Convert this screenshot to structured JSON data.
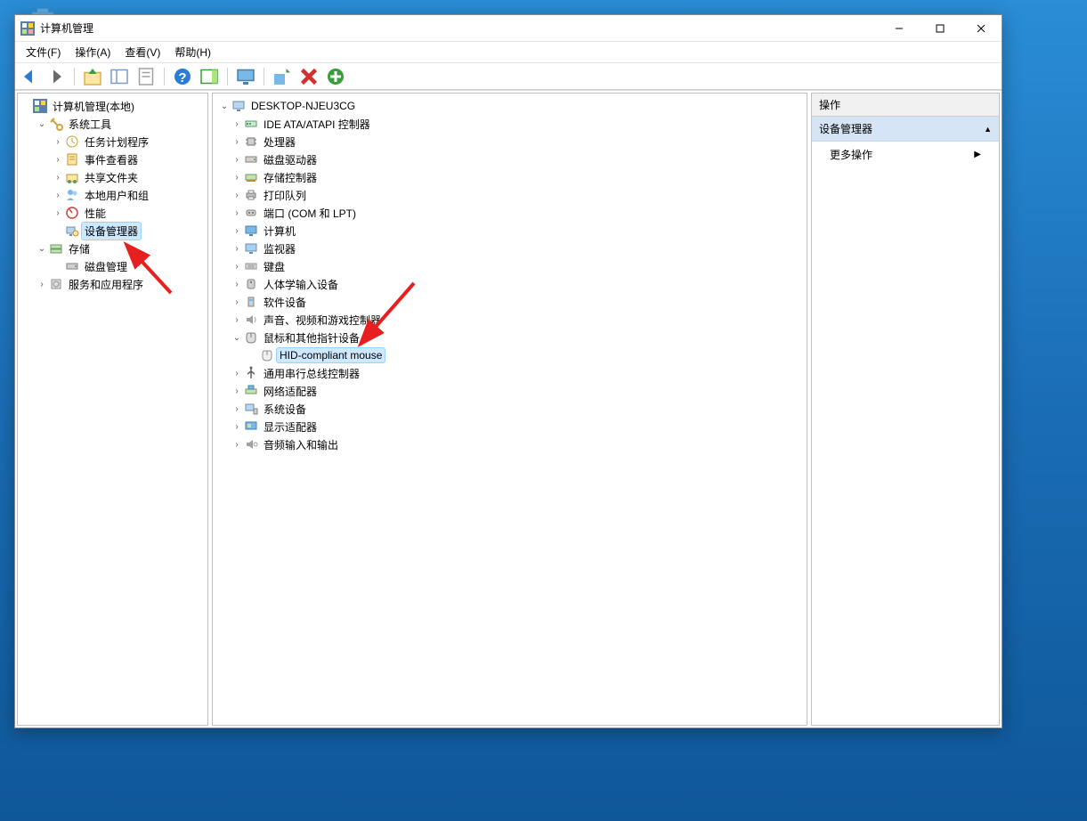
{
  "window": {
    "title": "计算机管理"
  },
  "menubar": {
    "items": [
      "文件(F)",
      "操作(A)",
      "查看(V)",
      "帮助(H)"
    ]
  },
  "left_tree": {
    "root": "计算机管理(本地)",
    "system_tools": {
      "label": "系统工具",
      "task_scheduler": "任务计划程序",
      "event_viewer": "事件查看器",
      "shared_folders": "共享文件夹",
      "local_users": "本地用户和组",
      "performance": "性能",
      "device_manager": "设备管理器"
    },
    "storage": {
      "label": "存储",
      "disk_mgmt": "磁盘管理"
    },
    "services": "服务和应用程序"
  },
  "center_tree": {
    "root": "DESKTOP-NJEU3CG",
    "items": {
      "ide": "IDE ATA/ATAPI 控制器",
      "processor": "处理器",
      "disk_drives": "磁盘驱动器",
      "storage_ctrl": "存储控制器",
      "print_queue": "打印队列",
      "ports": "端口 (COM 和 LPT)",
      "computer": "计算机",
      "monitor": "监视器",
      "keyboard": "键盘",
      "hid": "人体学输入设备",
      "software_dev": "软件设备",
      "sound": "声音、视频和游戏控制器",
      "mouse": "鼠标和其他指针设备",
      "hid_mouse": "HID-compliant mouse",
      "usb": "通用串行总线控制器",
      "network": "网络适配器",
      "system_dev": "系统设备",
      "display": "显示适配器",
      "audio_io": "音频输入和输出"
    }
  },
  "actions_pane": {
    "header": "操作",
    "section": "设备管理器",
    "more": "更多操作"
  }
}
